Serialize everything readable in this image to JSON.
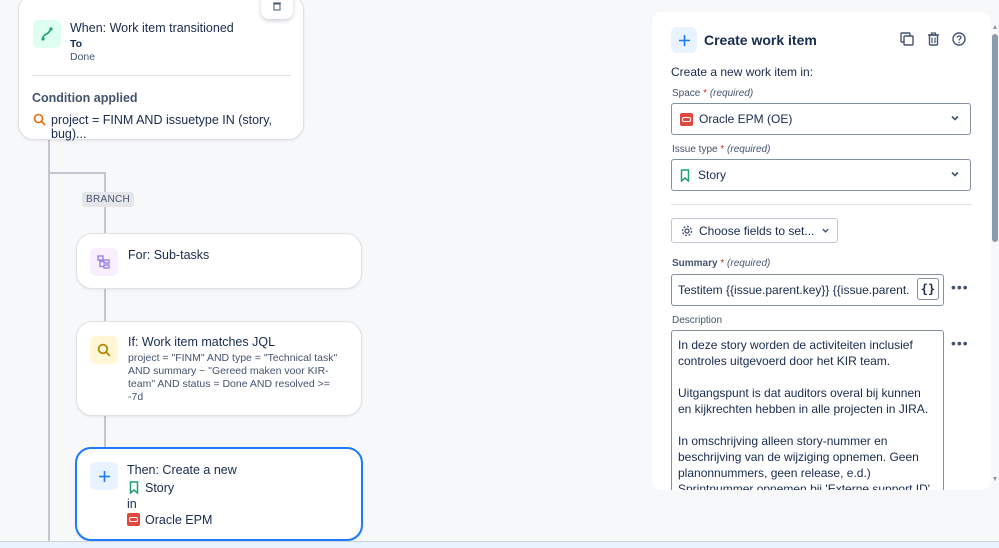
{
  "canvas": {
    "trigger": {
      "title": "When: Work item transitioned",
      "to_label": "To",
      "to_value": "Done",
      "condition_heading": "Condition applied",
      "condition_text": "project = FINM AND issuetype IN (story, bug)..."
    },
    "branch_tag": "BRANCH",
    "branch_card": {
      "title": "For: Sub-tasks"
    },
    "jql_card": {
      "title": "If: Work item matches JQL",
      "line1": "project = \"FINM\" AND type = \"Technical task\"",
      "line2": "AND summary ~ \"Gereed maken voor KIR-",
      "line3": "team\" AND status = Done AND resolved >=",
      "line4": "-7d"
    },
    "action_card": {
      "title": "Then: Create a new",
      "issue_type": "Story",
      "in_label": "in",
      "space": "Oracle EPM"
    }
  },
  "panel": {
    "title": "Create work item",
    "subtitle": "Create a new work item in:",
    "space_label": "Space",
    "space_required": "(required)",
    "space_value": "Oracle EPM (OE)",
    "issue_type_label": "Issue type",
    "issue_type_required": "(required)",
    "issue_type_value": "Story",
    "choose_fields_label": "Choose fields to set...",
    "summary_label": "Summary",
    "summary_required": "(required)",
    "summary_value": "Testitem {{issue.parent.key}} {{issue.parent.",
    "braces_label": "{}",
    "description_label": "Description",
    "description_p1": "In deze story worden de activiteiten inclusief controles uitgevoerd door het KIR team.",
    "description_p2": "Uitgangspunt is dat auditors overal bij kunnen en kijkrechten hebben in alle projecten in JIRA.",
    "description_p3": "In omschrijving alleen story-nummer en beschrijving van de wijziging opnemen. Geen planonnummers, geen release, e.d.) Sprintnummer opnemen bij 'Externe support ID'."
  },
  "colors": {
    "accent": "#1d7afc",
    "story_green": "#22a06b",
    "required_red": "#c9372c",
    "oracle_orange": "#e2483d"
  }
}
